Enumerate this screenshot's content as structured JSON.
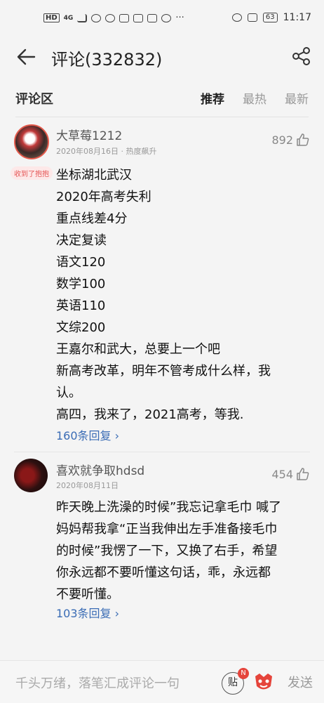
{
  "status_bar": {
    "left_labels": [
      "HD",
      "4G"
    ],
    "battery": "63",
    "time": "11:17"
  },
  "header": {
    "title": "评论(332832)"
  },
  "tabs": {
    "section_label": "评论区",
    "sort_options": [
      "推荐",
      "最热",
      "最新"
    ],
    "active": "推荐"
  },
  "comments": [
    {
      "username": "大草莓1212",
      "badge": "收到了抱抱",
      "date": "2020年08月16日",
      "tag": "热度飙升",
      "likes": "892",
      "lines": [
        "坐标湖北武汉",
        "2020年高考失利",
        "重点线差4分",
        "决定复读",
        "语文120",
        "数学100",
        "英语110",
        "文综200",
        "王嘉尔和武大，总要上一个吧",
        "新高考改革，明年不管考成什么样，我",
        "认。",
        "高四，我来了，2021高考，等我."
      ],
      "replies": "160条回复 ›"
    },
    {
      "username": "喜欢就争取hdsd",
      "date": "2020年08月11日",
      "likes": "454",
      "lines": [
        "昨天晚上洗澡的时候”我忘记拿毛巾 喊了",
        "妈妈帮我拿“正当我伸出左手准备接毛巾",
        "的时候”我愣了一下，又换了右手，希望",
        "你永远都不要听懂这句话，乖，永远都",
        "不要听懂。"
      ],
      "replies": "103条回复 ›"
    }
  ],
  "input_bar": {
    "placeholder": "千头万绪，落笔汇成评论一句",
    "tie_label": "贴",
    "tie_badge": "N",
    "send_label": "发送"
  }
}
